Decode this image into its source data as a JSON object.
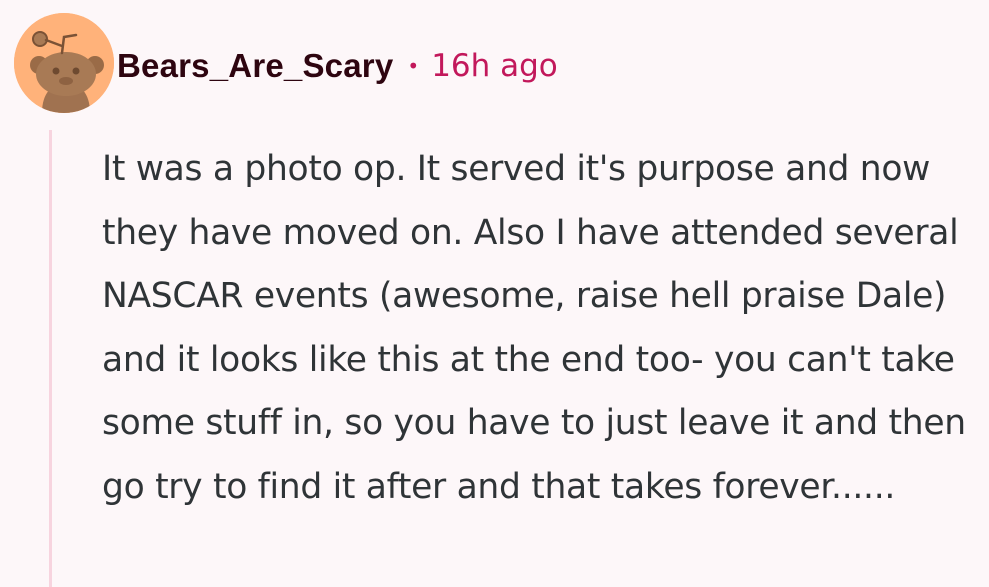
{
  "comment": {
    "username": "Bears_Are_Scary",
    "separator": "•",
    "timestamp": "16h ago",
    "body": "It was a photo op. It served it's purpose and now they have moved on. Also I have attended several NASCAR events (awesome, raise hell praise Dale) and it looks like this at the end too- you can't take some stuff in, so you have to just leave it and then go try to find it after and that takes forever......"
  },
  "avatar": {
    "icon": "snoo-bear-avatar-icon",
    "background_color": "#ffb27a"
  },
  "colors": {
    "page_background": "#fdf7f9",
    "username": "#2e0510",
    "accent": "#c2185b",
    "body_text": "#2f3437",
    "thread_line": "#f7d4df"
  }
}
